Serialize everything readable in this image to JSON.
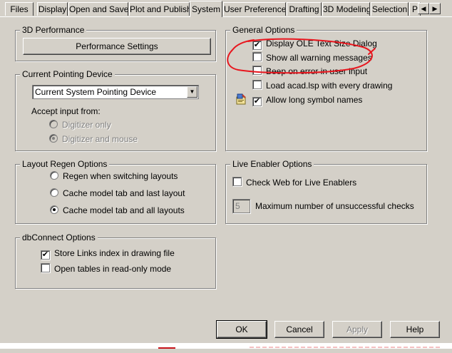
{
  "tabs": [
    {
      "label": "Files",
      "active": false
    },
    {
      "label": "Display",
      "active": false
    },
    {
      "label": "Open and Save",
      "active": false
    },
    {
      "label": "Plot and Publish",
      "active": false
    },
    {
      "label": "System",
      "active": true
    },
    {
      "label": "User Preferences",
      "active": false
    },
    {
      "label": "Drafting",
      "active": false
    },
    {
      "label": "3D Modeling",
      "active": false
    },
    {
      "label": "Selection",
      "active": false
    },
    {
      "label": "P",
      "active": false
    }
  ],
  "tab_scroll": {
    "left": "◀",
    "right": "▶"
  },
  "perf": {
    "title": "3D Performance",
    "button": "Performance Settings"
  },
  "pointing": {
    "title": "Current Pointing Device",
    "selected": "Current System Pointing Device",
    "accept_label": "Accept input from:",
    "options": [
      {
        "label": "Digitizer only",
        "checked": false,
        "disabled": true
      },
      {
        "label": "Digitizer and mouse",
        "checked": true,
        "disabled": true
      }
    ]
  },
  "regen": {
    "title": "Layout Regen Options",
    "options": [
      {
        "label": "Regen when switching layouts",
        "checked": false
      },
      {
        "label": "Cache model tab and last layout",
        "checked": false
      },
      {
        "label": "Cache model tab and all layouts",
        "checked": true
      }
    ]
  },
  "dbconnect": {
    "title": "dbConnect Options",
    "options": [
      {
        "label": "Store Links index in drawing file",
        "checked": true
      },
      {
        "label": "Open tables in read-only mode",
        "checked": false
      }
    ]
  },
  "general": {
    "title": "General Options",
    "options": [
      {
        "label": "Display OLE Text Size Dialog",
        "checked": true
      },
      {
        "label": "Show all warning messages",
        "checked": false
      },
      {
        "label": "Beep on error in user input",
        "checked": false
      },
      {
        "label": "Load acad.lsp with every drawing",
        "checked": false
      },
      {
        "label": "Allow long symbol names",
        "checked": true
      }
    ]
  },
  "live_enabler": {
    "title": "Live Enabler Options",
    "check_web": {
      "label": "Check Web for Live Enablers",
      "checked": false
    },
    "max_checks": {
      "value": "5",
      "label": "Maximum number of unsuccessful checks"
    }
  },
  "buttons": {
    "ok": "OK",
    "cancel": "Cancel",
    "apply": "Apply",
    "help": "Help"
  },
  "colors": {
    "face": "#d4d0c8",
    "annotation_red": "#e8161e"
  }
}
